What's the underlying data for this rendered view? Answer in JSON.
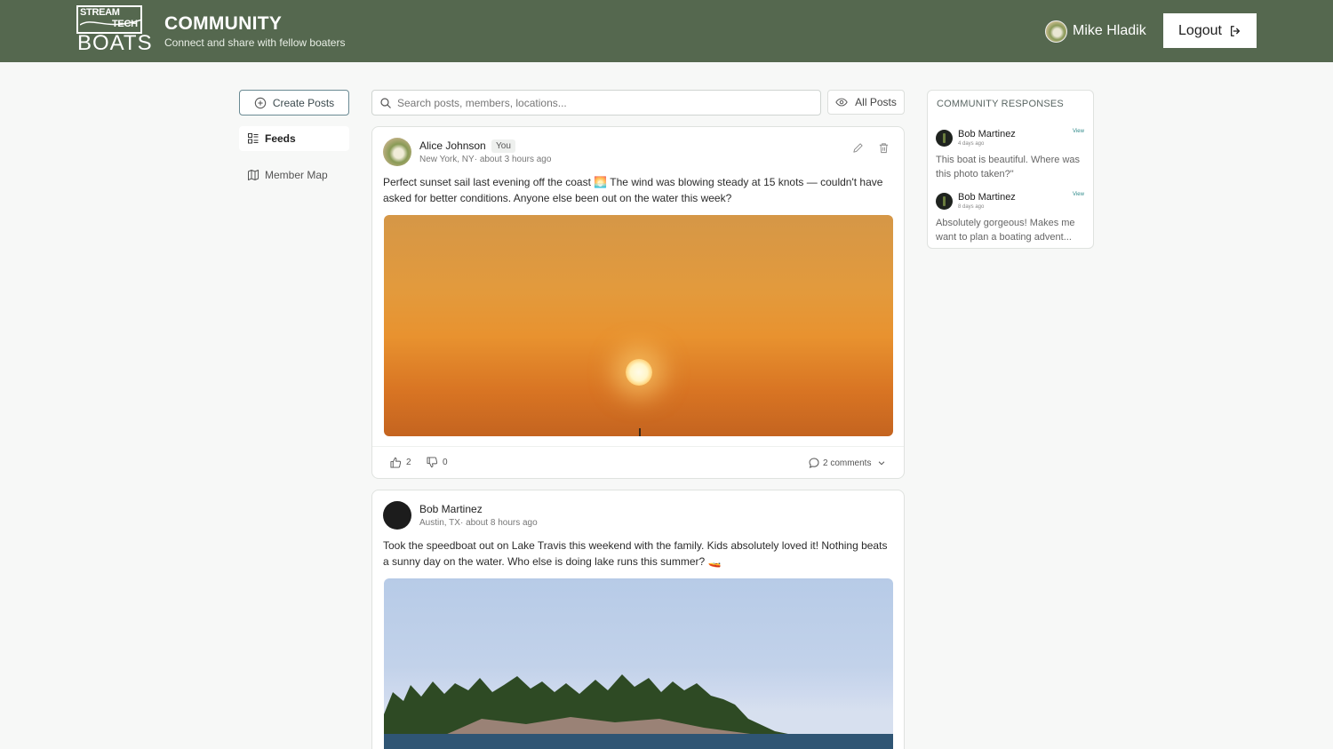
{
  "header": {
    "logo_line1": "STREAM",
    "logo_line2": "TECH",
    "logo_line3": "BOATS",
    "title": "COMMUNITY",
    "subtitle": "Connect and share with fellow boaters",
    "user_name": "Mike Hladik",
    "logout_label": "Logout",
    "bg_color": "#55684f"
  },
  "sidebar": {
    "create_label": "Create Posts",
    "items": [
      {
        "label": "Feeds",
        "icon": "list-icon",
        "active": true
      },
      {
        "label": "Member Map",
        "icon": "map-icon",
        "active": false
      }
    ]
  },
  "search": {
    "placeholder": "Search posts, members, locations...",
    "value": "",
    "filter_label": "All Posts"
  },
  "posts": [
    {
      "author": "Alice Johnson",
      "badge": "You",
      "location": "New York, NY",
      "time": "about 3 hours ago",
      "text": "Perfect sunset sail last evening off the coast 🌅 The wind was blowing steady at 15 knots — couldn't have asked for better conditions. Anyone else been out on the water this week?",
      "likes": "2",
      "dislikes": "0",
      "comments": "2 comments"
    },
    {
      "author": "Bob Martinez",
      "location": "Austin, TX",
      "time": "about 8 hours ago",
      "text": "Took the speedboat out on Lake Travis this weekend with the family. Kids absolutely loved it! Nothing beats a sunny day on the water. Who else is doing lake runs this summer? 🚤"
    }
  ],
  "responses": {
    "title": "COMMUNITY RESPONSES",
    "items": [
      {
        "name": "Bob Martinez",
        "time": "4 days ago",
        "view": "View",
        "text": "This boat is beautiful. Where was this photo taken?\""
      },
      {
        "name": "Bob Martinez",
        "time": "8 days ago",
        "view": "View",
        "text": "Absolutely gorgeous! Makes me want to plan a boating advent..."
      }
    ]
  }
}
